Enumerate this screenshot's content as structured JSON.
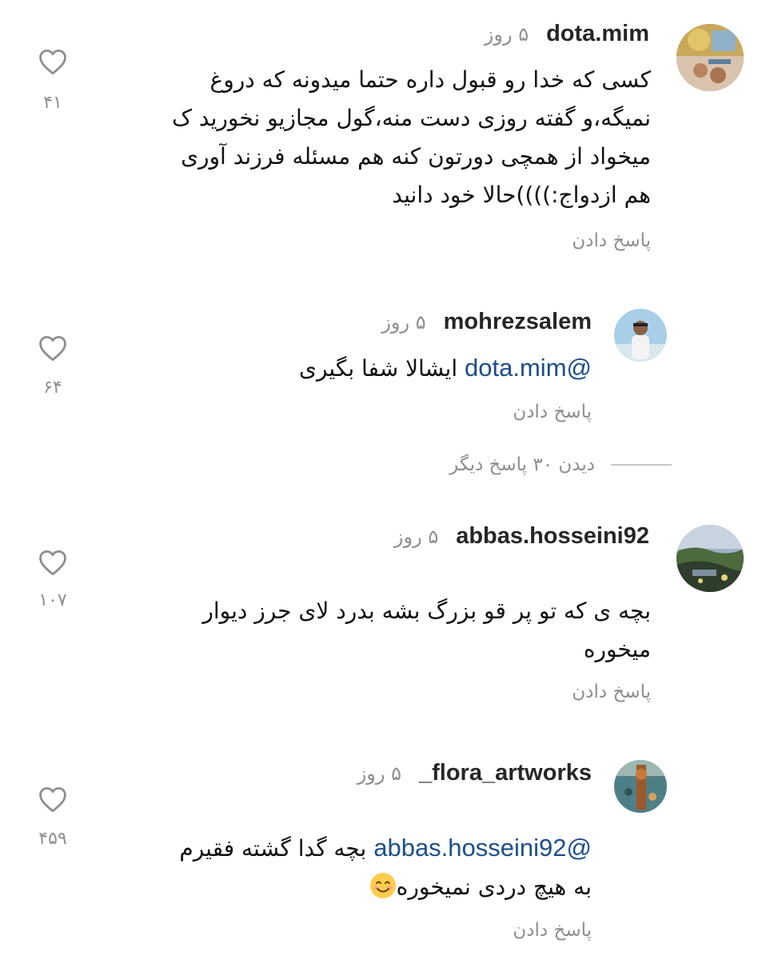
{
  "comments": [
    {
      "username": "dota.mim",
      "time": "۵ روز",
      "lines": [
        "کسی که خدا رو قبول داره حتما میدونه که دروغ",
        "نمیگه،و گفته روزی دست منه،گول مجازیو نخورید ک",
        "میخواد از همچی دورتون کنه هم مسئله فرزند آوری",
        "هم ازدواج:))))حالا خود دانید"
      ],
      "reply_label": "پاسخ دادن",
      "likes": "۴۱"
    },
    {
      "username": "mohrezsalem",
      "time": "۵ روز",
      "mention": "@dota.mim",
      "text": "ایشالا شفا بگیری",
      "reply_label": "پاسخ دادن",
      "likes": "۶۴",
      "view_replies": "دیدن ۳۰ پاسخ دیگر"
    },
    {
      "username": "abbas.hosseini92",
      "time": "۵ روز",
      "lines": [
        "بچه ی که تو پر قو بزرگ بشه بدرد لای جرز دیوار",
        "میخوره"
      ],
      "reply_label": "پاسخ دادن",
      "likes": "۱۰۷"
    },
    {
      "username": "_flora_artworks",
      "time": "۵ روز",
      "mention": "@abbas.hosseini92",
      "text": "بچه گدا گشته فقیرم",
      "line2": "به هیچ دردی نمیخوره",
      "emoji": "smiling-face-emoji",
      "reply_label": "پاسخ دادن",
      "likes": "۴۵۹"
    }
  ],
  "icons": {
    "like": "heart-outline-icon"
  },
  "colors": {
    "mention": "#1d4e89",
    "secondary_text": "#8e8e8e",
    "username": "#262626"
  }
}
